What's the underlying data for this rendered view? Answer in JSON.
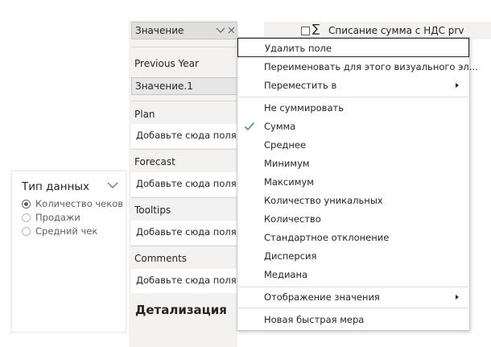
{
  "slicer": {
    "title": "Тип данных",
    "options": [
      {
        "label": "Количество чеков",
        "selected": true
      },
      {
        "label": "Продажи",
        "selected": false
      },
      {
        "label": "Средний чек",
        "selected": false
      }
    ]
  },
  "wells": {
    "value_field": "Значение",
    "previous_year_label": "Previous Year",
    "previous_year_field": "Значение.1",
    "plan_label": "Plan",
    "plan_drop": "Добавьте сюда поля с",
    "forecast_label": "Forecast",
    "forecast_drop": "Добавьте сюда поля с",
    "tooltips_label": "Tooltips",
    "tooltips_drop": "Добавьте сюда поля с",
    "comments_label": "Comments",
    "comments_drop": "Добавьте сюда поля с",
    "drillthrough_title": "Детализация"
  },
  "top_field": {
    "sigma": "∑",
    "label": "Списание сумма с НДС prv"
  },
  "menu": {
    "remove": "Удалить поле",
    "rename": "Переименовать для этого визуального эл...",
    "move": "Переместить в",
    "aggregations": [
      {
        "label": "Не суммировать",
        "checked": false
      },
      {
        "label": "Сумма",
        "checked": true
      },
      {
        "label": "Среднее",
        "checked": false
      },
      {
        "label": "Минимум",
        "checked": false
      },
      {
        "label": "Максимум",
        "checked": false
      },
      {
        "label": "Количество уникальных",
        "checked": false
      },
      {
        "label": "Количество",
        "checked": false
      },
      {
        "label": "Стандартное отклонение",
        "checked": false
      },
      {
        "label": "Дисперсия",
        "checked": false
      },
      {
        "label": "Медиана",
        "checked": false
      }
    ],
    "show_value_as": "Отображение значения",
    "new_quick_measure": "Новая быстрая мера"
  },
  "colors": {
    "check": "#4f8f86",
    "pane_bg": "#f3f2f1"
  }
}
